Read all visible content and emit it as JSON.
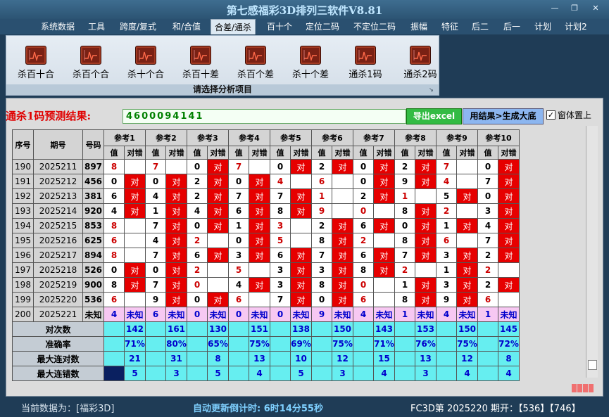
{
  "window": {
    "title": "第七感福彩3D排列三软件V8.81"
  },
  "menu": [
    "系统数据",
    "工具",
    "跨度/复式",
    "和/合值",
    "合差/通杀",
    "百十个",
    "定位二码",
    "不定位二码",
    "振幅",
    "特征",
    "后二",
    "后一",
    "计划",
    "计划2"
  ],
  "ribbon": {
    "buttons": [
      "杀百十合",
      "杀百个合",
      "杀十个合",
      "杀百十差",
      "杀百个差",
      "杀十个差",
      "通杀1码",
      "通杀2码"
    ],
    "group_label": "请选择分析项目"
  },
  "prediction": {
    "label": "通杀1码预测结果:",
    "value": "4600094141",
    "export_button": "导出excel",
    "generate_button": "用结果>生成大底",
    "pin_checkbox": "窗体置上",
    "pin_checked": true
  },
  "table": {
    "headers": {
      "seq": "序号",
      "issue": "期号",
      "number": "号码",
      "value": "值",
      "result": "对错"
    },
    "ref_labels": [
      "参考1",
      "参考2",
      "参考3",
      "参考4",
      "参考5",
      "参考6",
      "参考7",
      "参考8",
      "参考9",
      "参考10"
    ],
    "hit_text": "对",
    "rows": [
      {
        "seq": "190",
        "issue": "2025211",
        "number": "897",
        "cells": [
          [
            "8",
            "r",
            0
          ],
          [
            "7",
            "r",
            0
          ],
          [
            "0",
            "b",
            1
          ],
          [
            "7",
            "r",
            0
          ],
          [
            "0",
            "b",
            1
          ],
          [
            "2",
            "b",
            1
          ],
          [
            "0",
            "b",
            1
          ],
          [
            "2",
            "b",
            1
          ],
          [
            "7",
            "r",
            0
          ],
          [
            "0",
            "b",
            1
          ]
        ]
      },
      {
        "seq": "191",
        "issue": "2025212",
        "number": "456",
        "cells": [
          [
            "0",
            "b",
            1
          ],
          [
            "0",
            "b",
            1
          ],
          [
            "2",
            "b",
            1
          ],
          [
            "0",
            "b",
            1
          ],
          [
            "4",
            "r",
            0
          ],
          [
            "6",
            "r",
            0
          ],
          [
            "0",
            "b",
            1
          ],
          [
            "9",
            "b",
            1
          ],
          [
            "4",
            "r",
            0
          ],
          [
            "7",
            "b",
            1
          ]
        ]
      },
      {
        "seq": "192",
        "issue": "2025213",
        "number": "381",
        "cells": [
          [
            "6",
            "b",
            1
          ],
          [
            "4",
            "b",
            1
          ],
          [
            "2",
            "b",
            1
          ],
          [
            "7",
            "b",
            1
          ],
          [
            "7",
            "b",
            1
          ],
          [
            "1",
            "r",
            0
          ],
          [
            "2",
            "b",
            1
          ],
          [
            "1",
            "r",
            0
          ],
          [
            "5",
            "b",
            1
          ],
          [
            "0",
            "b",
            1
          ]
        ]
      },
      {
        "seq": "193",
        "issue": "2025214",
        "number": "920",
        "cells": [
          [
            "4",
            "b",
            1
          ],
          [
            "1",
            "b",
            1
          ],
          [
            "4",
            "b",
            1
          ],
          [
            "6",
            "b",
            1
          ],
          [
            "8",
            "b",
            1
          ],
          [
            "9",
            "r",
            0
          ],
          [
            "0",
            "r",
            0
          ],
          [
            "8",
            "b",
            1
          ],
          [
            "2",
            "r",
            0
          ],
          [
            "3",
            "b",
            1
          ]
        ]
      },
      {
        "seq": "194",
        "issue": "2025215",
        "number": "853",
        "cells": [
          [
            "8",
            "r",
            0
          ],
          [
            "7",
            "b",
            1
          ],
          [
            "0",
            "b",
            1
          ],
          [
            "1",
            "b",
            1
          ],
          [
            "3",
            "r",
            0
          ],
          [
            "2",
            "b",
            1
          ],
          [
            "6",
            "b",
            1
          ],
          [
            "0",
            "b",
            1
          ],
          [
            "1",
            "b",
            1
          ],
          [
            "4",
            "b",
            1
          ]
        ]
      },
      {
        "seq": "195",
        "issue": "2025216",
        "number": "625",
        "cells": [
          [
            "6",
            "r",
            0
          ],
          [
            "4",
            "b",
            1
          ],
          [
            "2",
            "r",
            0
          ],
          [
            "0",
            "b",
            1
          ],
          [
            "5",
            "r",
            0
          ],
          [
            "8",
            "b",
            1
          ],
          [
            "2",
            "r",
            0
          ],
          [
            "8",
            "b",
            1
          ],
          [
            "6",
            "r",
            0
          ],
          [
            "7",
            "b",
            1
          ]
        ]
      },
      {
        "seq": "196",
        "issue": "2025217",
        "number": "894",
        "cells": [
          [
            "8",
            "r",
            0
          ],
          [
            "7",
            "b",
            1
          ],
          [
            "6",
            "b",
            1
          ],
          [
            "3",
            "b",
            1
          ],
          [
            "6",
            "b",
            1
          ],
          [
            "7",
            "b",
            1
          ],
          [
            "6",
            "b",
            1
          ],
          [
            "7",
            "b",
            1
          ],
          [
            "3",
            "b",
            1
          ],
          [
            "2",
            "b",
            1
          ]
        ]
      },
      {
        "seq": "197",
        "issue": "2025218",
        "number": "526",
        "cells": [
          [
            "0",
            "b",
            1
          ],
          [
            "0",
            "b",
            1
          ],
          [
            "2",
            "r",
            0
          ],
          [
            "5",
            "r",
            0
          ],
          [
            "3",
            "b",
            1
          ],
          [
            "3",
            "b",
            1
          ],
          [
            "8",
            "b",
            1
          ],
          [
            "2",
            "r",
            0
          ],
          [
            "1",
            "b",
            1
          ],
          [
            "2",
            "r",
            0
          ]
        ]
      },
      {
        "seq": "198",
        "issue": "2025219",
        "number": "900",
        "cells": [
          [
            "8",
            "b",
            1
          ],
          [
            "7",
            "b",
            1
          ],
          [
            "0",
            "r",
            0
          ],
          [
            "4",
            "b",
            1
          ],
          [
            "3",
            "b",
            1
          ],
          [
            "8",
            "b",
            1
          ],
          [
            "0",
            "r",
            0
          ],
          [
            "1",
            "b",
            1
          ],
          [
            "3",
            "b",
            1
          ],
          [
            "2",
            "b",
            1
          ]
        ]
      },
      {
        "seq": "199",
        "issue": "2025220",
        "number": "536",
        "cells": [
          [
            "6",
            "r",
            0
          ],
          [
            "9",
            "b",
            1
          ],
          [
            "0",
            "b",
            1
          ],
          [
            "6",
            "r",
            0
          ],
          [
            "7",
            "b",
            1
          ],
          [
            "0",
            "b",
            1
          ],
          [
            "6",
            "r",
            0
          ],
          [
            "8",
            "b",
            1
          ],
          [
            "9",
            "b",
            1
          ],
          [
            "6",
            "r",
            0
          ]
        ]
      }
    ],
    "unknown_row": {
      "seq": "200",
      "issue": "2025221",
      "number": "未知",
      "values": [
        "4",
        "6",
        "0",
        "0",
        "0",
        "9",
        "4",
        "1",
        "4",
        "1"
      ],
      "result": "未知"
    },
    "stats": [
      {
        "label": "对次数",
        "values": [
          "142",
          "161",
          "130",
          "151",
          "138",
          "150",
          "143",
          "153",
          "150",
          "145"
        ]
      },
      {
        "label": "准确率",
        "values": [
          "71%",
          "80%",
          "65%",
          "75%",
          "69%",
          "75%",
          "71%",
          "76%",
          "75%",
          "72%"
        ]
      },
      {
        "label": "最大连对数",
        "values": [
          "21",
          "31",
          "8",
          "13",
          "10",
          "12",
          "15",
          "13",
          "12",
          "8"
        ]
      },
      {
        "label": "最大连错数",
        "values": [
          "5",
          "3",
          "5",
          "4",
          "5",
          "3",
          "4",
          "3",
          "4",
          "4"
        ]
      }
    ]
  },
  "status": {
    "current_data": "当前数据为：[福彩3D]",
    "countdown": "自动更新倒计时:  6时14分55秒",
    "draw_info": "FC3D第 2025220 期开：【536】【746】"
  },
  "colors": {
    "hit": "#e60000",
    "stat_bg": "#66eef0",
    "unknown_bg": "#f7c8f2",
    "title": "#bfe6ff"
  }
}
